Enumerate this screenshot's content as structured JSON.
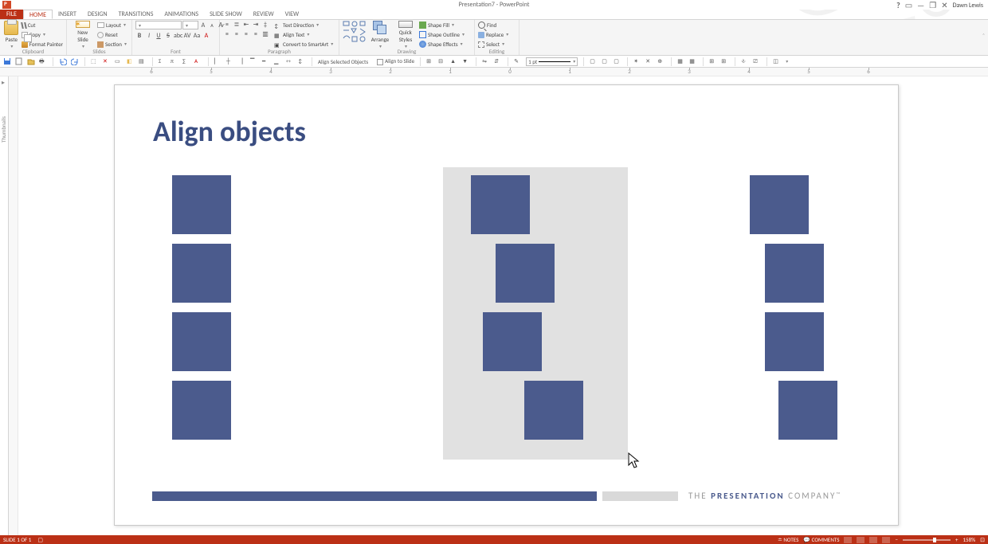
{
  "window": {
    "title": "Presentation7 - PowerPoint",
    "user": "Dawn Lewis"
  },
  "tabs": [
    "FILE",
    "HOME",
    "INSERT",
    "DESIGN",
    "TRANSITIONS",
    "ANIMATIONS",
    "SLIDE SHOW",
    "REVIEW",
    "VIEW"
  ],
  "active_tab": "HOME",
  "ribbon": {
    "clipboard": {
      "label": "Clipboard",
      "paste": "Paste",
      "cut": "Cut",
      "copy": "Copy",
      "format_painter": "Format Painter"
    },
    "slides": {
      "label": "Slides",
      "new_slide": "New\nSlide",
      "layout": "Layout",
      "reset": "Reset",
      "section": "Section"
    },
    "font": {
      "label": "Font",
      "font_name": "",
      "font_size": ""
    },
    "paragraph": {
      "label": "Paragraph",
      "text_direction": "Text Direction",
      "align_text": "Align Text",
      "convert_smartart": "Convert to SmartArt"
    },
    "drawing": {
      "label": "Drawing",
      "arrange": "Arrange",
      "quick_styles": "Quick\nStyles",
      "shape_fill": "Shape Fill",
      "shape_outline": "Shape Outline",
      "shape_effects": "Shape Effects"
    },
    "editing": {
      "label": "Editing",
      "find": "Find",
      "replace": "Replace",
      "select": "Select"
    }
  },
  "subtoolbar": {
    "align_selected": "Align Selected Objects",
    "align_to_slide": "Align to Slide",
    "weight": "1 pt"
  },
  "ruler_numbers": [
    "6",
    "5",
    "4",
    "3",
    "2",
    "1",
    "0",
    "1",
    "2",
    "3",
    "4",
    "5",
    "6"
  ],
  "thumbnails_label": "Thumbnails",
  "slide": {
    "title": "Align objects",
    "footer": {
      "the": "THE",
      "strong": "PRESENTATION",
      "company": "COMPANY",
      "tm": "™"
    }
  },
  "status": {
    "slide_counter": "SLIDE 1 OF 1",
    "notes": "NOTES",
    "comments": "COMMENTS",
    "zoom": "158%"
  }
}
